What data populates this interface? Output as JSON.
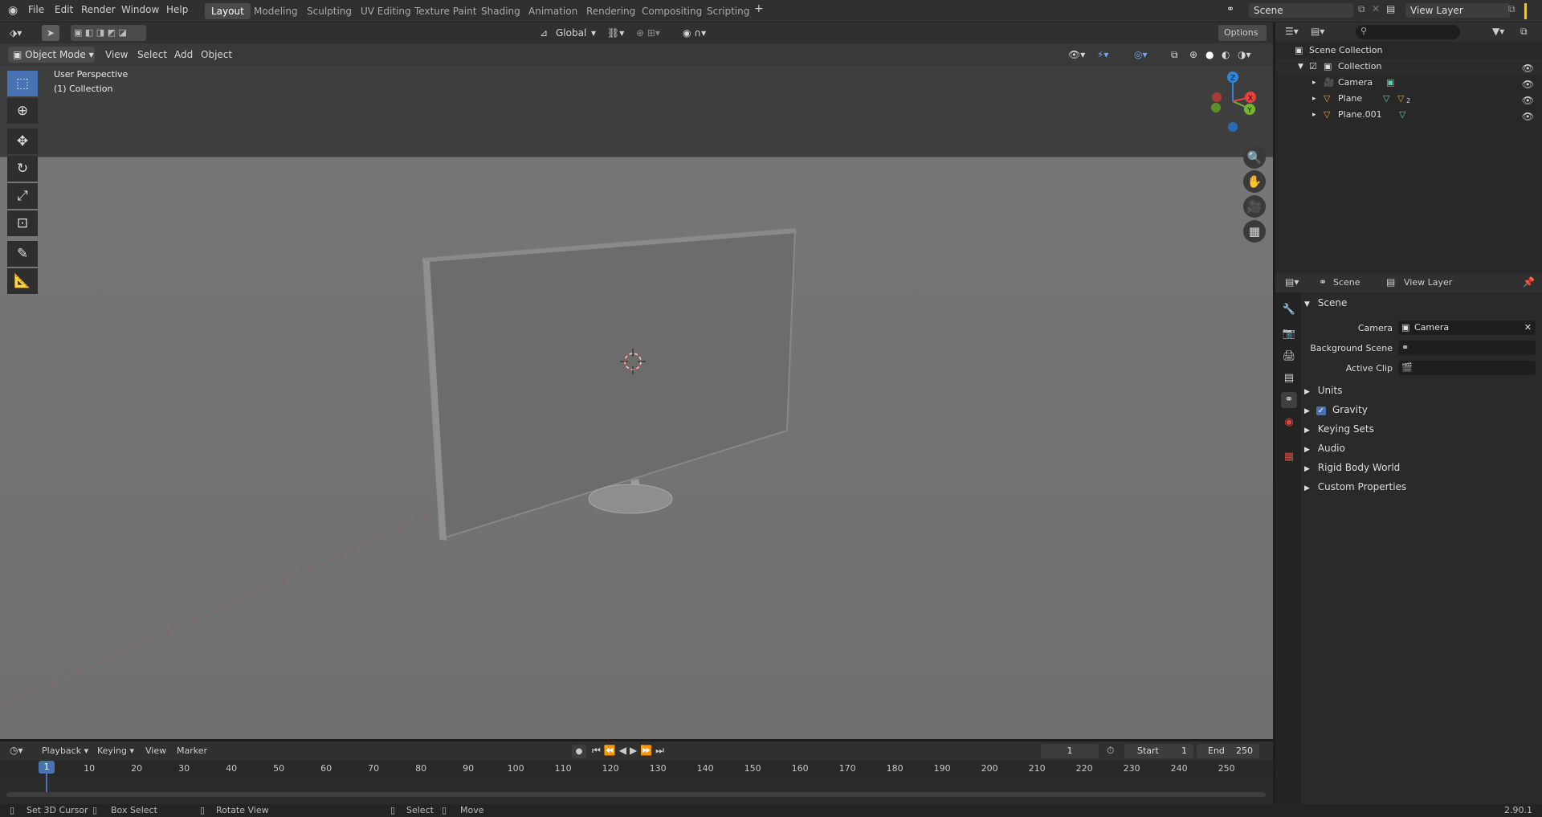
{
  "topbar": {
    "menus": [
      "File",
      "Edit",
      "Render",
      "Window",
      "Help"
    ],
    "workspaces": [
      "Layout",
      "Modeling",
      "Sculpting",
      "UV Editing",
      "Texture Paint",
      "Shading",
      "Animation",
      "Rendering",
      "Compositing",
      "Scripting"
    ],
    "active_workspace": "Layout",
    "add_workspace": "+",
    "scene": "Scene",
    "view_layer": "View Layer"
  },
  "viewport": {
    "mode": "Object Mode",
    "menus": [
      "View",
      "Select",
      "Add",
      "Object"
    ],
    "transform_orientation": "Global",
    "options": "Options",
    "overlay_title": "User Perspective",
    "overlay_subtitle": "(1) Collection",
    "gizmo": {
      "x": "X",
      "y": "Y",
      "z": "Z"
    }
  },
  "outliner": {
    "search_placeholder": "",
    "root": "Scene Collection",
    "collection": "Collection",
    "items": [
      "Camera",
      "Plane",
      "Plane.001"
    ],
    "plane_badge": "2"
  },
  "properties": {
    "header_scene": "Scene",
    "header_view_layer": "View Layer",
    "section": "Scene",
    "camera_label": "Camera",
    "camera_value": "Camera",
    "background_scene_label": "Background Scene",
    "active_clip_label": "Active Clip",
    "panels": [
      "Units",
      "Gravity",
      "Keying Sets",
      "Audio",
      "Rigid Body World",
      "Custom Properties"
    ],
    "gravity_checked": true
  },
  "timeline": {
    "menus": [
      "Playback",
      "Keying",
      "View",
      "Marker"
    ],
    "current_frame": "1",
    "start_label": "Start",
    "start": "1",
    "end_label": "End",
    "end": "250",
    "ticks": [
      "1",
      "10",
      "20",
      "30",
      "40",
      "50",
      "60",
      "70",
      "80",
      "90",
      "100",
      "110",
      "120",
      "130",
      "140",
      "150",
      "160",
      "170",
      "180",
      "190",
      "200",
      "210",
      "220",
      "230",
      "240",
      "250"
    ]
  },
  "statusbar": {
    "items": [
      "Set 3D Cursor",
      "Box Select",
      "Rotate View",
      "Select",
      "Move"
    ],
    "version": "2.90.1"
  },
  "colors": {
    "accent": "#4772b3",
    "axis_x": "#e8403b",
    "axis_y": "#71b62c",
    "axis_z": "#2e86d8"
  }
}
